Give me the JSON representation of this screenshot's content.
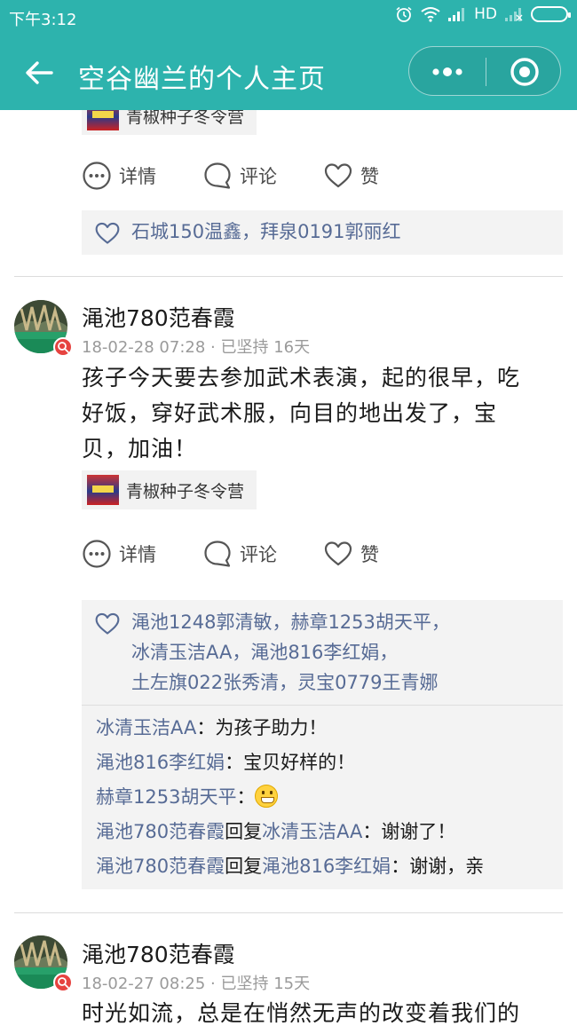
{
  "status_bar": {
    "time": "下午3:12",
    "network": "HD",
    "icons": [
      "alarm-icon",
      "wifi-icon",
      "signal-icon",
      "signal-weak-icon",
      "battery-icon"
    ]
  },
  "header": {
    "title": "空谷幽兰的个人主页",
    "back_icon": "back-arrow-icon",
    "more_icon": "more-dots-icon",
    "close_icon": "target-close-icon",
    "bg_color": "#2db3ad"
  },
  "feed": {
    "posts": [
      {
        "course": "青椒种子冬令营",
        "actions": {
          "detail": "详情",
          "comment": "评论",
          "like": "赞"
        },
        "likes": "石城150温鑫，拜泉0191郭丽红"
      },
      {
        "author": "渑池780范春霞",
        "date": "18-02-28 07:28",
        "persist": "已坚持 16天",
        "text_lines": [
          "孩子今天要去参加武术表演，起的很早，吃",
          "好饭，穿好武术服，向目的地出发了，宝",
          "贝，加油！"
        ],
        "course": "青椒种子冬令营",
        "actions": {
          "detail": "详情",
          "comment": "评论",
          "like": "赞"
        },
        "likes_lines": [
          "渑池1248郭清敏，赫章1253胡天平，",
          "冰清玉洁AA，渑池816李红娟，",
          "土左旗022张秀清，灵宝0779王青娜"
        ],
        "comments": [
          {
            "name": "冰清玉洁AA",
            "sep": "：",
            "text": "为孩子助力！"
          },
          {
            "name": "渑池816李红娟",
            "sep": "：",
            "text": "宝贝好样的！"
          },
          {
            "name": "赫章1253胡天平",
            "sep": "：",
            "text": "",
            "emoji": "grin-emoji-icon"
          },
          {
            "name": "渑池780范春霞",
            "reply": "回复",
            "to": "冰清玉洁AA",
            "sep": "：",
            "text": "谢谢了！"
          },
          {
            "name": "渑池780范春霞",
            "reply": "回复",
            "to": "渑池816李红娟",
            "sep": "：",
            "text": "谢谢，亲"
          }
        ]
      },
      {
        "author": "渑池780范春霞",
        "date": "18-02-27 08:25",
        "persist": "已坚持 15天",
        "text_lines": [
          "时光如流，总是在悄然无声的改变着我们的"
        ]
      }
    ]
  },
  "colors": {
    "link": "#576b95",
    "muted": "#9a9a9a",
    "panel": "#f3f3f3"
  }
}
